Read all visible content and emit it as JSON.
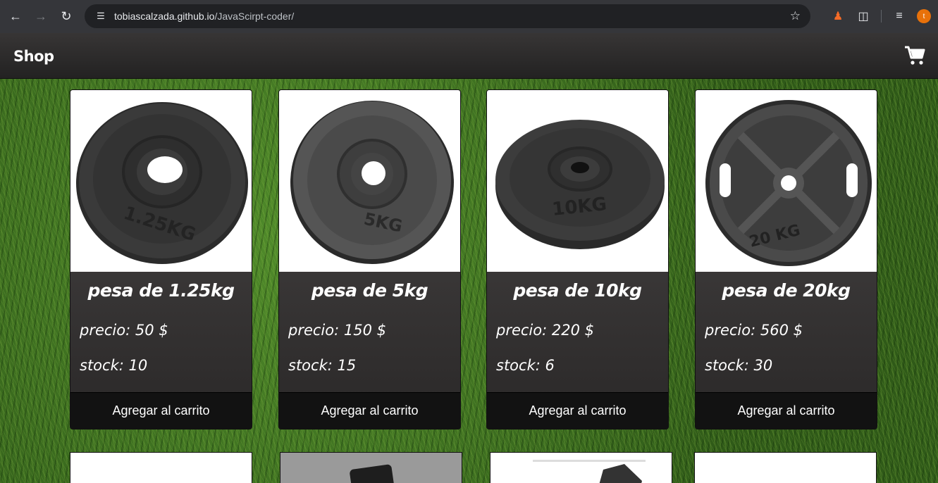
{
  "browser": {
    "url_host": "tobiascalzada.github.io",
    "url_path": "/JavaScirpt-coder/",
    "avatar_letter": "t"
  },
  "header": {
    "title": "Shop"
  },
  "products": [
    {
      "name": "pesa de 1.25kg",
      "price": "precio: 50 $",
      "stock": "stock: 10",
      "button": "Agregar al carrito",
      "plate_label": "1.25KG"
    },
    {
      "name": "pesa de 5kg",
      "price": "precio: 150 $",
      "stock": "stock: 15",
      "button": "Agregar al carrito",
      "plate_label": "5KG"
    },
    {
      "name": "pesa de 10kg",
      "price": "precio: 220 $",
      "stock": "stock: 6",
      "button": "Agregar al carrito",
      "plate_label": "10KG"
    },
    {
      "name": "pesa de 20kg",
      "price": "precio: 560 $",
      "stock": "stock: 30",
      "button": "Agregar al carrito",
      "plate_label": "20 KG"
    }
  ],
  "colors": {
    "header_bg": "#2d2c2c",
    "card_bg": "#3a3838",
    "button_bg": "#121212",
    "grass": "#3a6b1e"
  }
}
